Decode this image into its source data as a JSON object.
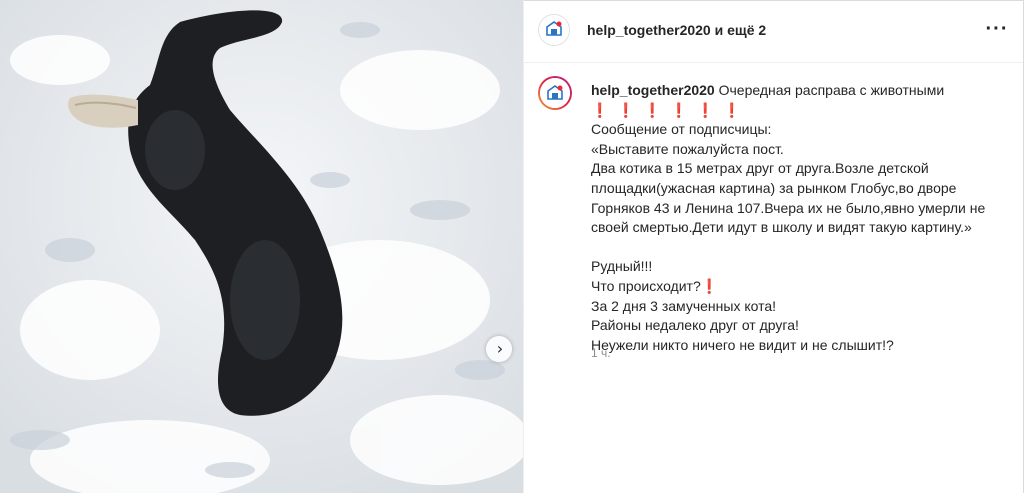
{
  "header": {
    "username": "help_together2020",
    "suffix": " и ещё 2",
    "more_icon": "more-horizontal-icon"
  },
  "post": {
    "username": "help_together2020",
    "first_line": " Очередная расправа с животными",
    "exclamations": "❗❗❗❗❗❗",
    "lines": [
      "Сообщение от подписчицы:",
      "«Выставите пожалуйста пост.",
      "Два котика в 15 метрах друг от друга.Возле детской",
      "площадки(ужасная картина) за рынком Глобус,во дворе",
      "Горняков 43 и Ленина 107.Вчера их не было,явно умерли не",
      "своей смертью.Дети идут в школу и видят такую картину.»",
      "",
      "Рудный!!!",
      "Что происходит?❗",
      "За 2 дня 3 замученных кота!",
      "Районы недалеко друг от друга!",
      "Неужели никто ничего не видит и не слышит!?"
    ],
    "time": "1 ч."
  },
  "carousel": {
    "next_icon": "chevron-right-icon",
    "next_glyph": "›"
  },
  "colors": {
    "text": "#262626",
    "muted": "#8e8e8e",
    "accent_red": "#e8283f",
    "snow": "#eef1f4"
  }
}
